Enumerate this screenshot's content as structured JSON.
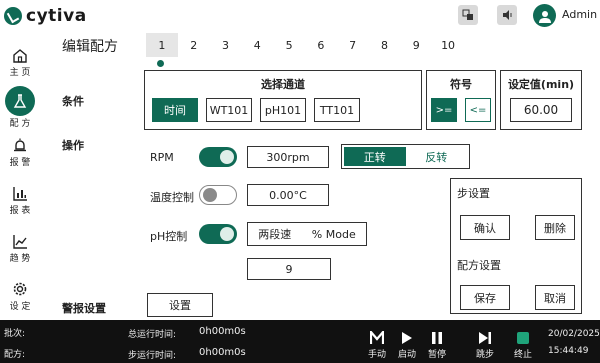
{
  "header": {
    "brand": "cytiva",
    "user": "Admin",
    "icons": [
      "language-icon",
      "volume-icon",
      "user-avatar-icon"
    ]
  },
  "sidebar": {
    "items": [
      {
        "label": "主 页",
        "icon": "home-icon"
      },
      {
        "label": "配 方",
        "icon": "flask-icon"
      },
      {
        "label": "报 警",
        "icon": "alarm-icon"
      },
      {
        "label": "报 表",
        "icon": "report-icon"
      },
      {
        "label": "趋 势",
        "icon": "trend-icon"
      },
      {
        "label": "设 定",
        "icon": "settings-icon"
      }
    ],
    "active_index": 1
  },
  "page": {
    "title": "编辑配方",
    "step_tabs": [
      "1",
      "2",
      "3",
      "4",
      "5",
      "6",
      "7",
      "8",
      "9",
      "10"
    ],
    "active_step": 0
  },
  "sections": {
    "condition": "条件",
    "operation": "操作",
    "alarm_settings": "警报设置"
  },
  "channel_panel": {
    "title": "选择通道",
    "options": [
      "时间",
      "WT101",
      "pH101",
      "TT101"
    ],
    "selected": 0
  },
  "sign_panel": {
    "title": "符号",
    "options": [
      ">=",
      "<="
    ],
    "selected": 0
  },
  "setpoint_panel": {
    "title": "设定值(min)",
    "value": "60.00"
  },
  "operations": {
    "rpm": {
      "label": "RPM",
      "enabled": true,
      "value": "300rpm",
      "direction_options": [
        "正转",
        "反转"
      ],
      "direction_selected": 0
    },
    "temperature": {
      "label": "温度控制",
      "enabled": false,
      "value": "0.00°C"
    },
    "ph": {
      "label": "pH控制",
      "enabled": true,
      "mode_left": "两段速",
      "mode_right": "% Mode",
      "value": "9"
    }
  },
  "alarm": {
    "button": "设置"
  },
  "step_panel": {
    "step_title": "步设置",
    "confirm": "确认",
    "delete": "删除",
    "recipe_title": "配方设置",
    "save": "保存",
    "cancel": "取消"
  },
  "footer": {
    "batch_label": "批次:",
    "recipe_label": "配方:",
    "total_time_label": "总运行时间:",
    "total_time_value": "0h00m0s",
    "step_time_label": "步运行时间:",
    "step_time_value": "0h00m0s",
    "controls": [
      {
        "label": "手动",
        "icon": "manual-icon"
      },
      {
        "label": "启动",
        "icon": "play-icon"
      },
      {
        "label": "暂停",
        "icon": "pause-icon"
      },
      {
        "label": "跳步",
        "icon": "skip-icon"
      },
      {
        "label": "终止",
        "icon": "stop-icon"
      }
    ],
    "date": "20/02/2025",
    "time": "15:44:49"
  },
  "colors": {
    "accent": "#0f6a55",
    "footer_bg": "#111111"
  }
}
